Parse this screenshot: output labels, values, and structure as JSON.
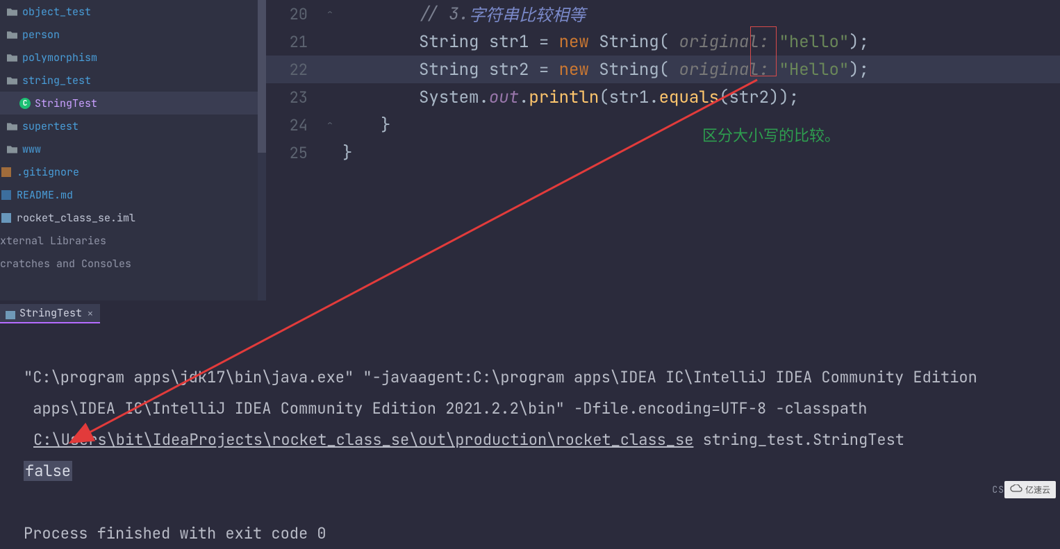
{
  "sidebar": {
    "items": [
      {
        "label": "object_test",
        "lvl": 1,
        "kind": "folder"
      },
      {
        "label": "person",
        "lvl": 1,
        "kind": "folder"
      },
      {
        "label": "polymorphism",
        "lvl": 1,
        "kind": "folder"
      },
      {
        "label": "string_test",
        "lvl": 1,
        "kind": "folder"
      },
      {
        "label": "StringTest",
        "lvl": 2,
        "kind": "class",
        "sel": true
      },
      {
        "label": "supertest",
        "lvl": 1,
        "kind": "folder"
      },
      {
        "label": "www",
        "lvl": 1,
        "kind": "folder"
      },
      {
        "label": ".gitignore",
        "lvl": 0,
        "kind": "git"
      },
      {
        "label": "README.md",
        "lvl": 0,
        "kind": "md"
      },
      {
        "label": "rocket_class_se.iml",
        "lvl": 0,
        "kind": "iml",
        "file": true
      },
      {
        "label": "xternal Libraries",
        "lvl": 0,
        "kind": "none",
        "muted": true
      },
      {
        "label": "cratches and Consoles",
        "lvl": 0,
        "kind": "none",
        "muted": true
      }
    ]
  },
  "editor": {
    "linenos": [
      "20",
      "21",
      "22",
      "23",
      "24",
      "25"
    ],
    "comment_prefix": "// 3.",
    "comment_cn": "字符串比较相等",
    "l21": {
      "kw": "String",
      "id": "str1",
      "op1": " = ",
      "new": "new ",
      "ty": "String",
      "hint": " original: ",
      "str": "\"hello\"",
      "end": ");"
    },
    "l22": {
      "kw": "String",
      "id": "str2",
      "op1": " = ",
      "new": "new ",
      "ty": "String",
      "hint": " original: ",
      "str": "\"Hello\"",
      "end": ");"
    },
    "l23": {
      "sys": "System.",
      "out": "out",
      "dot": ".",
      "m": "println",
      "open": "(",
      "a1": "str1.",
      "eq": "equals",
      "open2": "(",
      "a2": "str2",
      "close": "));"
    },
    "brace1": "}",
    "brace2": "}",
    "note": "区分大小写的比较。"
  },
  "run": {
    "tab": "StringTest",
    "line1a": "\"C:\\program apps\\jdk17\\bin\\java.exe\" \"-javaagent:C:\\program apps\\IDEA IC\\IntelliJ IDEA Community Edition",
    "line1b": " apps\\IDEA IC\\IntelliJ IDEA Community Edition 2021.2.2\\bin\" -Dfile.encoding=UTF-8 -classpath",
    "link": "C:\\Users\\bit\\IdeaProjects\\rocket_class_se\\out\\production\\rocket_class_se",
    "after_link": " string_test.StringTest",
    "output": "false",
    "exit": "Process finished with exit code 0"
  },
  "footer": {
    "csdn": "CS",
    "wm": "亿速云"
  }
}
